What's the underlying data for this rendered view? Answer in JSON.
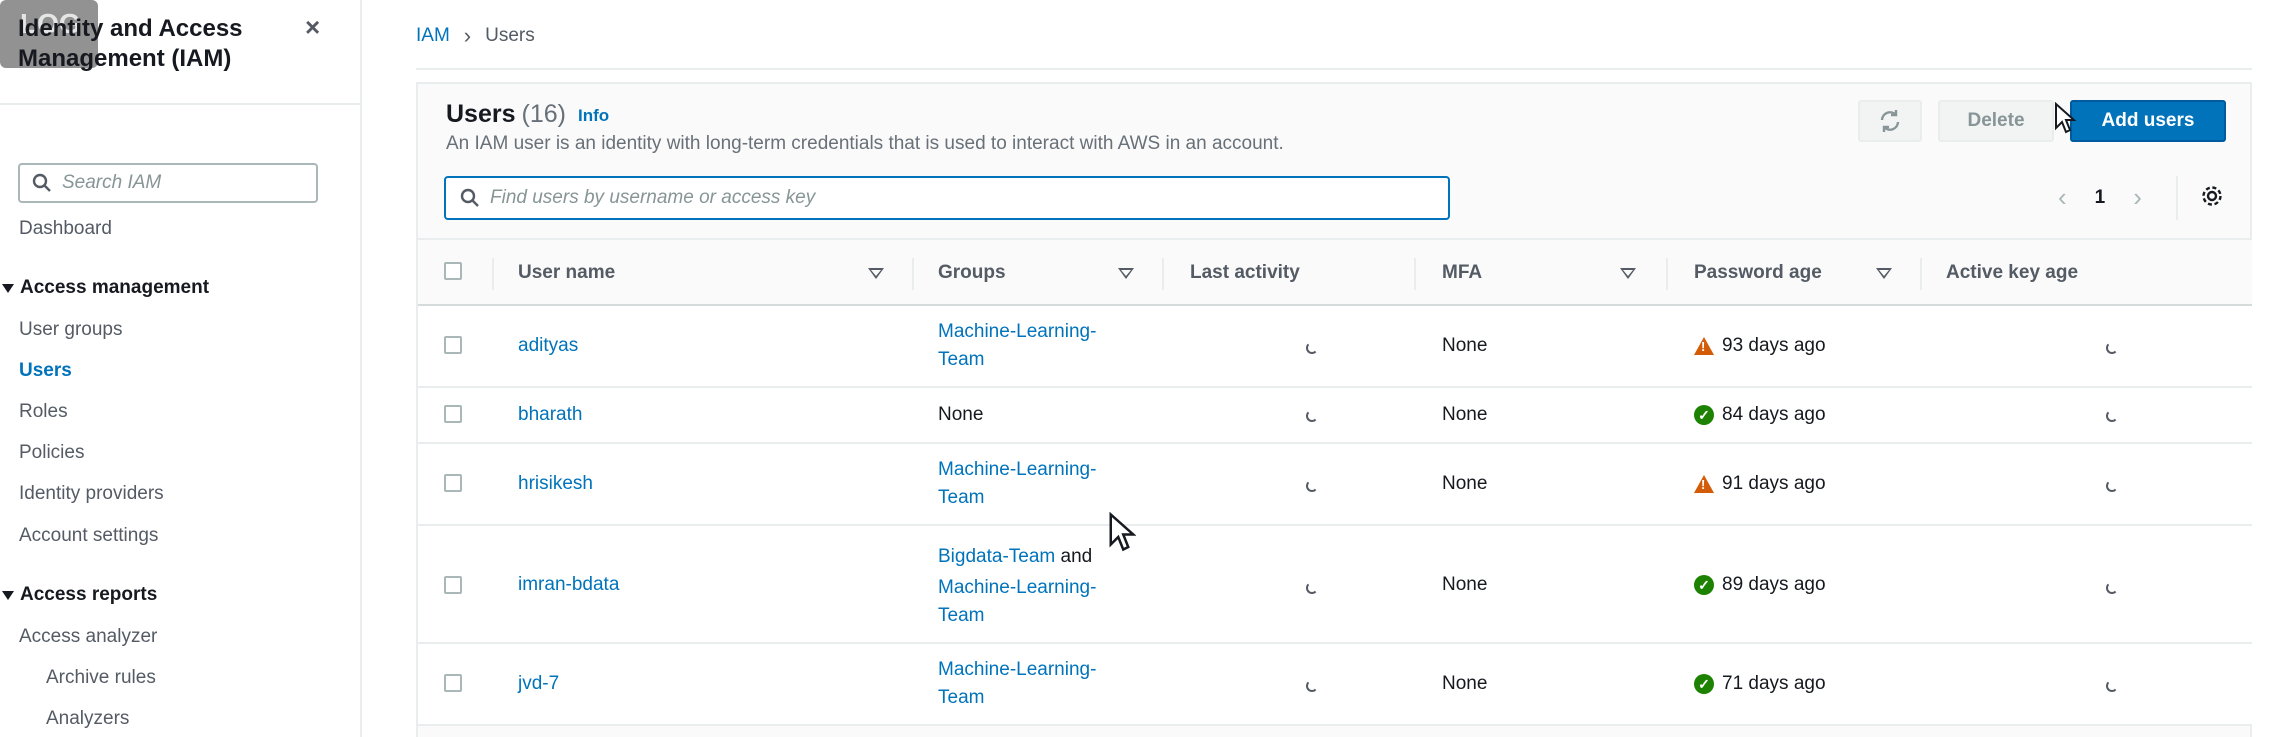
{
  "sidebar": {
    "logo_text": "LOG",
    "title": "Identity and Access Management (IAM)",
    "close_icon": "×",
    "search_placeholder": "Search IAM",
    "dashboard": "Dashboard",
    "access_management": {
      "label": "Access management",
      "items": [
        "User groups",
        "Users",
        "Roles",
        "Policies",
        "Identity providers",
        "Account settings"
      ],
      "active": "Users"
    },
    "access_reports": {
      "label": "Access reports",
      "items": [
        "Access analyzer",
        "Archive rules",
        "Analyzers"
      ]
    }
  },
  "breadcrumb": {
    "root": "IAM",
    "separator": "›",
    "current": "Users"
  },
  "users_panel": {
    "title": "Users",
    "count": "(16)",
    "info_label": "Info",
    "description": "An IAM user is an identity with long-term credentials that is used to interact with AWS in an account.",
    "refresh_icon": "refresh-icon",
    "delete_label": "Delete",
    "add_label": "Add users",
    "search_placeholder": "Find users by username or access key",
    "page_number": "1",
    "prev_icon": "‹",
    "next_icon": "›"
  },
  "table": {
    "columns": [
      "User name",
      "Groups",
      "Last activity",
      "MFA",
      "Password age",
      "Active key age"
    ],
    "rows": [
      {
        "user": "adityas",
        "groups": [
          {
            "text": "Machine-Learning-",
            "link": true
          },
          {
            "text": "Team",
            "link": true
          }
        ],
        "mfa": "None",
        "password_age": "93 days ago",
        "status": "warning"
      },
      {
        "user": "bharath",
        "groups": [
          {
            "text": "None",
            "link": false
          }
        ],
        "mfa": "None",
        "password_age": "84 days ago",
        "status": "ok"
      },
      {
        "user": "hrisikesh",
        "groups": [
          {
            "text": "Machine-Learning-",
            "link": true
          },
          {
            "text": "Team",
            "link": true
          }
        ],
        "mfa": "None",
        "password_age": "91 days ago",
        "status": "warning"
      },
      {
        "user": "imran-bdata",
        "groups_line1_link": "Bigdata-Team",
        "groups_line1_plain": " and",
        "groups_line2": "Machine-Learning-",
        "groups_line3": "Team",
        "mfa": "None",
        "password_age": "89 days ago",
        "status": "ok"
      },
      {
        "user": "jvd-7",
        "groups": [
          {
            "text": "Machine-Learning-",
            "link": true
          },
          {
            "text": "Team",
            "link": true
          }
        ],
        "mfa": "None",
        "password_age": "71 days ago",
        "status": "ok"
      }
    ]
  },
  "colors": {
    "link": "#0073bb",
    "primary_button": "#0073bb",
    "warning": "#d45b07",
    "success": "#1d8102"
  }
}
